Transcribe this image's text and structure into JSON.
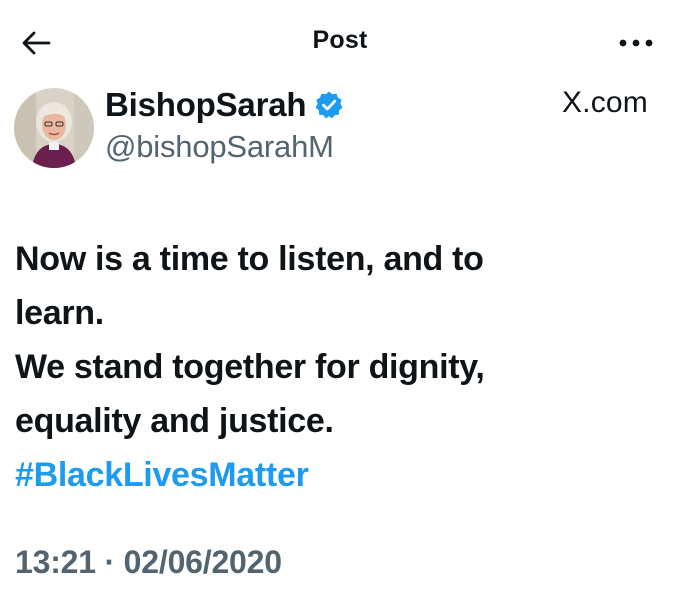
{
  "header": {
    "title": "Post",
    "back_icon": "arrow-left-icon",
    "more_icon": "more-horizontal-icon"
  },
  "post": {
    "author": {
      "display_name": "BishopSarah",
      "handle": "@bishopSarahM",
      "verified": true,
      "verified_color": "#1d9bf0"
    },
    "source_label": "X.com",
    "text_lines": [
      "Now is a time to listen, and to",
      "learn.",
      "We stand together for dignity,",
      "equality and justice."
    ],
    "hashtag": "#BlackLivesMatter",
    "timestamp": "13:21 · 02/06/2020"
  },
  "colors": {
    "text_primary": "#0f1419",
    "text_secondary": "#536471",
    "link": "#1d9bf0"
  }
}
